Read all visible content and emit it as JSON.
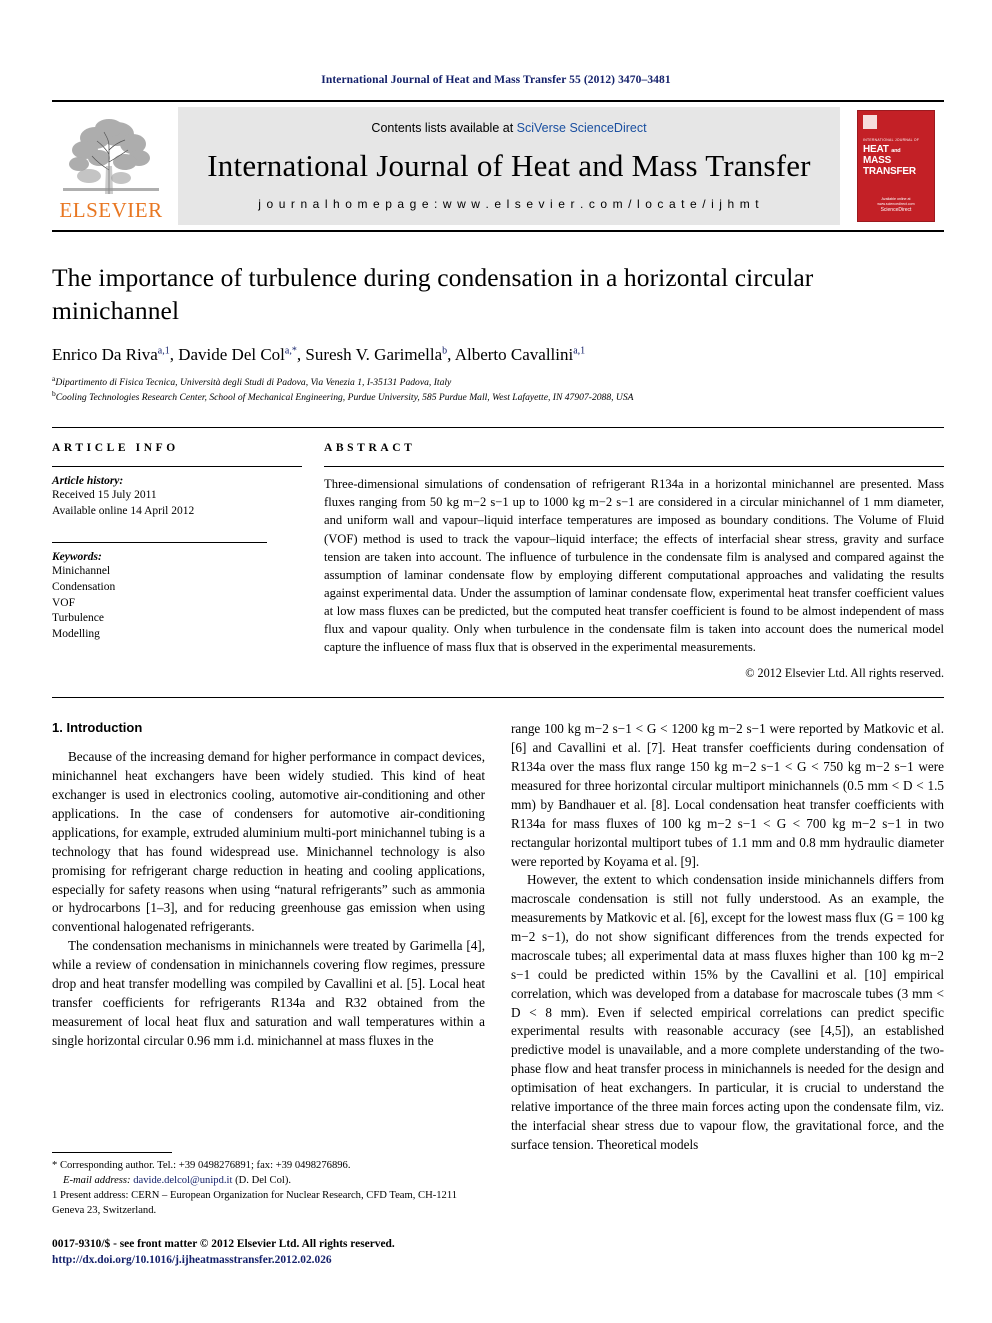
{
  "running_head": "International Journal of Heat and Mass Transfer 55 (2012) 3470–3481",
  "masthead": {
    "contents_prefix": "Contents lists available at ",
    "contents_link": "SciVerse ScienceDirect",
    "journal_title": "International Journal of Heat and Mass Transfer",
    "homepage": "j o u r n a l   h o m e p a g e :   w w w . e l s e v i e r . c o m / l o c a t e / i j h m t",
    "elsevier_word": "ELSEVIER",
    "cover": {
      "sub": "INTERNATIONAL JOURNAL OF",
      "main_line1": "HEAT",
      "main_and": "and",
      "main_line1b": "MASS",
      "main_line2": "TRANSFER",
      "foot_small": "Available online at www.sciencedirect.com",
      "foot_big": "ScienceDirect"
    }
  },
  "title": "The importance of turbulence during condensation in a horizontal circular minichannel",
  "authors": [
    {
      "name": "Enrico Da Riva",
      "sup": "a,1"
    },
    {
      "name": "Davide Del Col",
      "sup": "a,*"
    },
    {
      "name": "Suresh V. Garimella",
      "sup": "b"
    },
    {
      "name": "Alberto Cavallini",
      "sup": "a,1"
    }
  ],
  "affiliations": [
    {
      "marker": "a",
      "text": "Dipartimento di Fisica Tecnica, Università degli Studi di Padova, Via Venezia 1, I-35131 Padova, Italy"
    },
    {
      "marker": "b",
      "text": "Cooling Technologies Research Center, School of Mechanical Engineering, Purdue University, 585 Purdue Mall, West Lafayette, IN 47907-2088, USA"
    }
  ],
  "article_info": {
    "heading": "ARTICLE INFO",
    "history_label": "Article history:",
    "history": [
      "Received 15 July 2011",
      "Available online 14 April 2012"
    ],
    "keywords_label": "Keywords:",
    "keywords": [
      "Minichannel",
      "Condensation",
      "VOF",
      "Turbulence",
      "Modelling"
    ]
  },
  "abstract": {
    "heading": "ABSTRACT",
    "text": "Three-dimensional simulations of condensation of refrigerant R134a in a horizontal minichannel are presented. Mass fluxes ranging from 50 kg m−2 s−1 up to 1000 kg m−2 s−1 are considered in a circular minichannel of 1 mm diameter, and uniform wall and vapour–liquid interface temperatures are imposed as boundary conditions. The Volume of Fluid (VOF) method is used to track the vapour–liquid interface; the effects of interfacial shear stress, gravity and surface tension are taken into account. The influence of turbulence in the condensate film is analysed and compared against the assumption of laminar condensate flow by employing different computational approaches and validating the results against experimental data. Under the assumption of laminar condensate flow, experimental heat transfer coefficient values at low mass fluxes can be predicted, but the computed heat transfer coefficient is found to be almost independent of mass flux and vapour quality. Only when turbulence in the condensate film is taken into account does the numerical model capture the influence of mass flux that is observed in the experimental measurements.",
    "copyright": "© 2012 Elsevier Ltd. All rights reserved."
  },
  "section1": {
    "title": "1. Introduction",
    "left_paragraphs": [
      "Because of the increasing demand for higher performance in compact devices, minichannel heat exchangers have been widely studied. This kind of heat exchanger is used in electronics cooling, automotive air-conditioning and other applications. In the case of condensers for automotive air-conditioning applications, for example, extruded aluminium multi-port minichannel tubing is a technology that has found widespread use. Minichannel technology is also promising for refrigerant charge reduction in heating and cooling applications, especially for safety reasons when using “natural refrigerants” such as ammonia or hydrocarbons [1–3], and for reducing greenhouse gas emission when using conventional halogenated refrigerants.",
      "The condensation mechanisms in minichannels were treated by Garimella [4], while a review of condensation in minichannels covering flow regimes, pressure drop and heat transfer modelling was compiled by Cavallini et al. [5]. Local heat transfer coefficients for refrigerants R134a and R32 obtained from the measurement of local heat flux and saturation and wall temperatures within a single horizontal circular 0.96 mm i.d. minichannel at mass fluxes in the"
    ],
    "right_paragraphs": [
      "range 100 kg m−2 s−1 < G < 1200 kg m−2 s−1 were reported by Matkovic et al. [6] and Cavallini et al. [7]. Heat transfer coefficients during condensation of R134a over the mass flux range 150 kg m−2 s−1 < G < 750 kg m−2 s−1 were measured for three horizontal circular multiport minichannels (0.5 mm < D < 1.5 mm) by Bandhauer et al. [8]. Local condensation heat transfer coefficients with R134a for mass fluxes of 100 kg m−2 s−1 < G < 700 kg m−2 s−1 in two rectangular horizontal multiport tubes of 1.1 mm and 0.8 mm hydraulic diameter were reported by Koyama et al. [9].",
      "However, the extent to which condensation inside minichannels differs from macroscale condensation is still not fully understood. As an example, the measurements by Matkovic et al. [6], except for the lowest mass flux (G = 100 kg m−2 s−1), do not show significant differences from the trends expected for macroscale tubes; all experimental data at mass fluxes higher than 100 kg m−2 s−1 could be predicted within 15% by the Cavallini et al. [10] empirical correlation, which was developed from a database for macroscale tubes (3 mm < D < 8 mm). Even if selected empirical correlations can predict specific experimental results with reasonable accuracy (see [4,5]), an established predictive model is unavailable, and a more complete understanding of the two-phase flow and heat transfer process in minichannels is needed for the design and optimisation of heat exchangers. In particular, it is crucial to understand the relative importance of the three main forces acting upon the condensate film, viz. the interfacial shear stress due to vapour flow, the gravitational force, and the surface tension. Theoretical models"
    ]
  },
  "footnotes": {
    "corresponding": "* Corresponding author. Tel.: +39 0498276891; fax: +39 0498276896.",
    "email_label": "E-mail address:",
    "email": "davide.delcol@unipd.it",
    "email_suffix": "(D. Del Col).",
    "present_address": "1 Present address: CERN – European Organization for Nuclear Research, CFD Team, CH-1211 Geneva 23, Switzerland."
  },
  "footer": {
    "issn_line": "0017-9310/$ - see front matter © 2012 Elsevier Ltd. All rights reserved.",
    "doi": "http://dx.doi.org/10.1016/j.ijheatmasstransfer.2012.02.026"
  },
  "colors": {
    "link_blue": "#14216b",
    "sciencedirect_blue": "#1a4fa0",
    "elsevier_orange": "#e87722",
    "cover_red": "#c32026"
  }
}
